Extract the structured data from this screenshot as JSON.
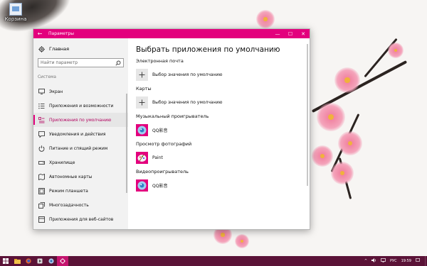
{
  "desktop": {
    "icon_label": "Корзина"
  },
  "window": {
    "title": "Параметры",
    "minimize": "—",
    "maximize": "☐",
    "close": "✕",
    "back": "←"
  },
  "nav": {
    "home_label": "Главная",
    "search_placeholder": "Найти параметр",
    "section_label": "Система",
    "items": [
      {
        "label": "Экран"
      },
      {
        "label": "Приложения и возможности"
      },
      {
        "label": "Приложения по умолчанию",
        "active": true
      },
      {
        "label": "Уведомления и действия"
      },
      {
        "label": "Питание и спящий режим"
      },
      {
        "label": "Хранилище"
      },
      {
        "label": "Автономные карты"
      },
      {
        "label": "Режим планшета"
      },
      {
        "label": "Многозадачность"
      },
      {
        "label": "Приложения для веб-сайтов"
      }
    ]
  },
  "main": {
    "title": "Выбрать приложения по умолчанию",
    "groups": [
      {
        "title": "Электронная почта",
        "app": "Выбор значения по умолчанию",
        "kind": "plus"
      },
      {
        "title": "Карты",
        "app": "Выбор значения по умолчанию",
        "kind": "plus"
      },
      {
        "title": "Музыкальный проигрыватель",
        "app": "QQ影音",
        "kind": "qq"
      },
      {
        "title": "Просмотр фотографий",
        "app": "Paint",
        "kind": "paint"
      },
      {
        "title": "Видеопроигрыватель",
        "app": "QQ影音",
        "kind": "qq"
      }
    ]
  },
  "taskbar": {
    "lang": "РУС",
    "time": "19:59"
  },
  "colors": {
    "accent": "#e3007d",
    "taskbar": "#5b1337"
  }
}
